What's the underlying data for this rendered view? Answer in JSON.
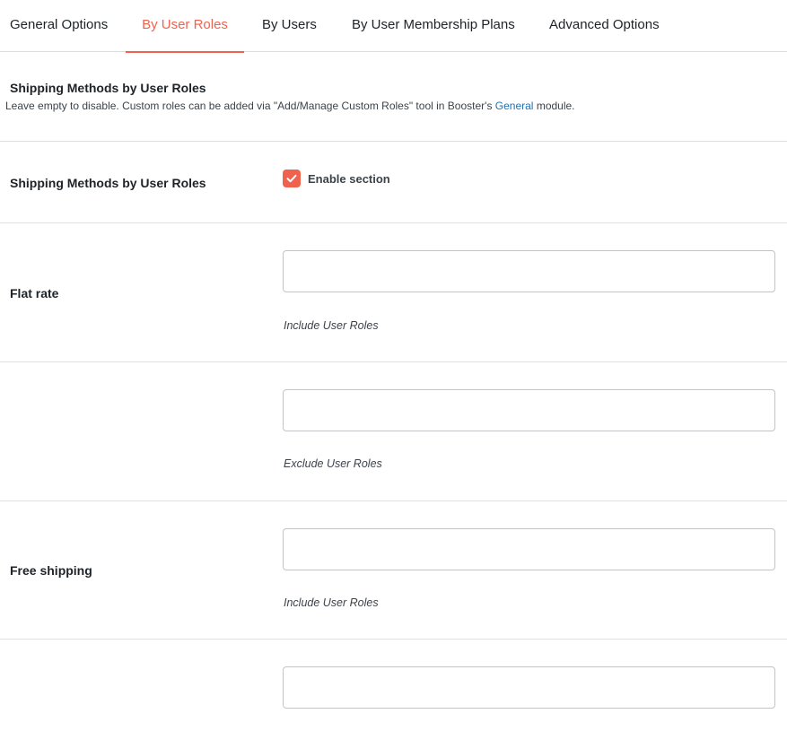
{
  "tabs": [
    {
      "label": "General Options",
      "active": false
    },
    {
      "label": "By User Roles",
      "active": true
    },
    {
      "label": "By Users",
      "active": false
    },
    {
      "label": "By User Membership Plans",
      "active": false
    },
    {
      "label": "Advanced Options",
      "active": false
    }
  ],
  "section": {
    "title": "Shipping Methods by User Roles",
    "desc_before": "Leave empty to disable. Custom roles can be added via \"Add/Manage Custom Roles\" tool in Booster's ",
    "desc_link": "General",
    "desc_after": " module."
  },
  "enable_row": {
    "label": "Shipping Methods by User Roles",
    "checkbox_label": "Enable section",
    "checked": true
  },
  "methods": [
    {
      "label": "Flat rate",
      "include_value": "",
      "include_hint": "Include User Roles",
      "exclude_value": "",
      "exclude_hint": "Exclude User Roles"
    },
    {
      "label": "Free shipping",
      "include_value": "",
      "include_hint": "Include User Roles",
      "exclude_value": ""
    }
  ],
  "colors": {
    "accent": "#f0624e",
    "link": "#2271b1"
  }
}
